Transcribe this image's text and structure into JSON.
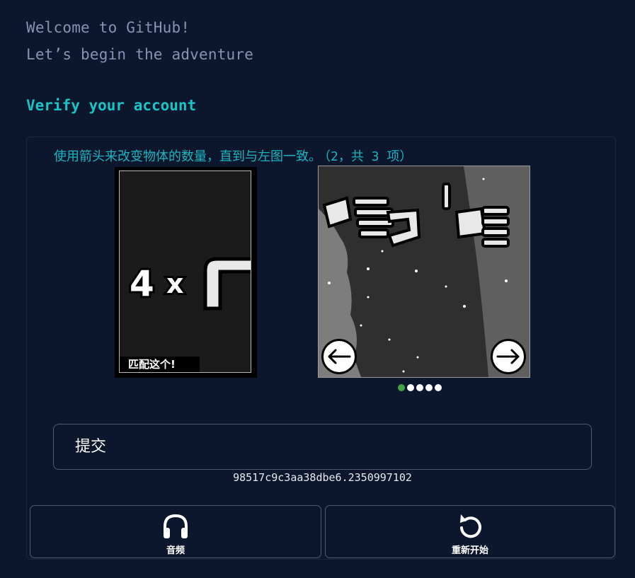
{
  "header": {
    "welcome_line_1": "Welcome to GitHub!",
    "welcome_line_2": "Let’s begin the adventure"
  },
  "verify": {
    "heading": "Verify your account"
  },
  "captcha": {
    "instruction": "使用箭头来改变物体的数量，直到与左图一致。",
    "progress": "（2，共 3 项）",
    "reference_image": {
      "count_text": "4",
      "times_text": "x",
      "label": "匹配这个!"
    },
    "pagination": {
      "total": 5,
      "active_index": 0
    },
    "submit_label": "提交",
    "session_id": "98517c9c3aa38dbe6.2350997102",
    "audio_label": "音频",
    "restart_label": "重新开始"
  },
  "colors": {
    "background": "#0c162d",
    "accent_teal": "#18c5c4",
    "muted_text": "#8594b2",
    "border": "#4c5a76",
    "active_dot": "#46a147"
  },
  "icons": {
    "left_arrow": "arrow-left-icon",
    "right_arrow": "arrow-right-icon",
    "audio": "headphones-icon",
    "restart": "restart-icon"
  }
}
